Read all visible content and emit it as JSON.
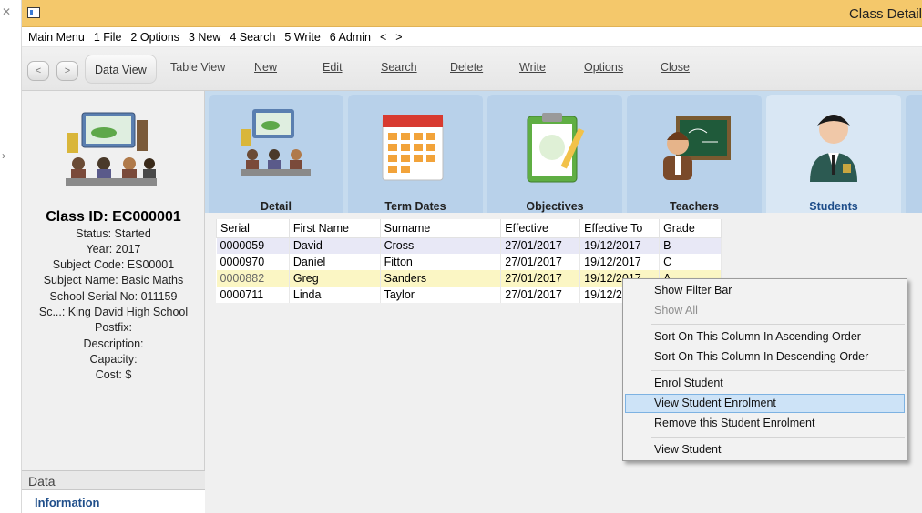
{
  "window": {
    "title": "Class Detail"
  },
  "menu": [
    "Main Menu",
    "1 File",
    "2 Options",
    "3 New",
    "4 Search",
    "5 Write",
    "6 Admin",
    "<",
    ">"
  ],
  "toolbar": {
    "back": "<",
    "forward": ">",
    "data_view": "Data View",
    "table_view": "Table View",
    "new": "New",
    "edit": "Edit",
    "search": "Search",
    "delete": "Delete",
    "write": "Write",
    "options": "Options",
    "close": "Close"
  },
  "class_summary": {
    "class_id": "Class ID: EC000001",
    "lines": [
      "Status: Started",
      "Year: 2017",
      "Subject Code: ES00001",
      "Subject Name: Basic Maths",
      "School Serial No: 011159",
      "Sc...: King David High School",
      "Postfix:",
      "Description:",
      "Capacity:",
      "Cost: $"
    ]
  },
  "left_sections": {
    "data": "Data",
    "information": "Information"
  },
  "tabs": [
    "Detail",
    "Term Dates",
    "Objectives",
    "Teachers",
    "Students"
  ],
  "grid": {
    "columns": [
      "Serial",
      "First Name",
      "Surname",
      "Effective",
      "Effective To",
      "Grade"
    ],
    "rows": [
      [
        "0000059",
        "David",
        "Cross",
        "27/01/2017",
        "19/12/2017",
        "B"
      ],
      [
        "0000970",
        "Daniel",
        "Fitton",
        "27/01/2017",
        "19/12/2017",
        "C"
      ],
      [
        "0000882",
        "Greg",
        "Sanders",
        "27/01/2017",
        "19/12/2017",
        "A"
      ],
      [
        "0000711",
        "Linda",
        "Taylor",
        "27/01/2017",
        "19/12/2017",
        ""
      ]
    ]
  },
  "context_menu": {
    "show_filter_bar": "Show Filter Bar",
    "show_all": "Show All",
    "sort_asc": "Sort On This Column In Ascending Order",
    "sort_desc": "Sort On This Column In Descending Order",
    "enrol_student": "Enrol Student",
    "view_student_enrolment": "View Student Enrolment",
    "remove_enrolment": "Remove this Student Enrolment",
    "view_student": "View Student"
  },
  "colors": {
    "titlebar": "#f4c86b",
    "tab_strip": "#c6dbee",
    "tab_active": "#d9e7f4",
    "row_highlight": "#fbf6c4",
    "menu_selection": "#cde3f7"
  }
}
